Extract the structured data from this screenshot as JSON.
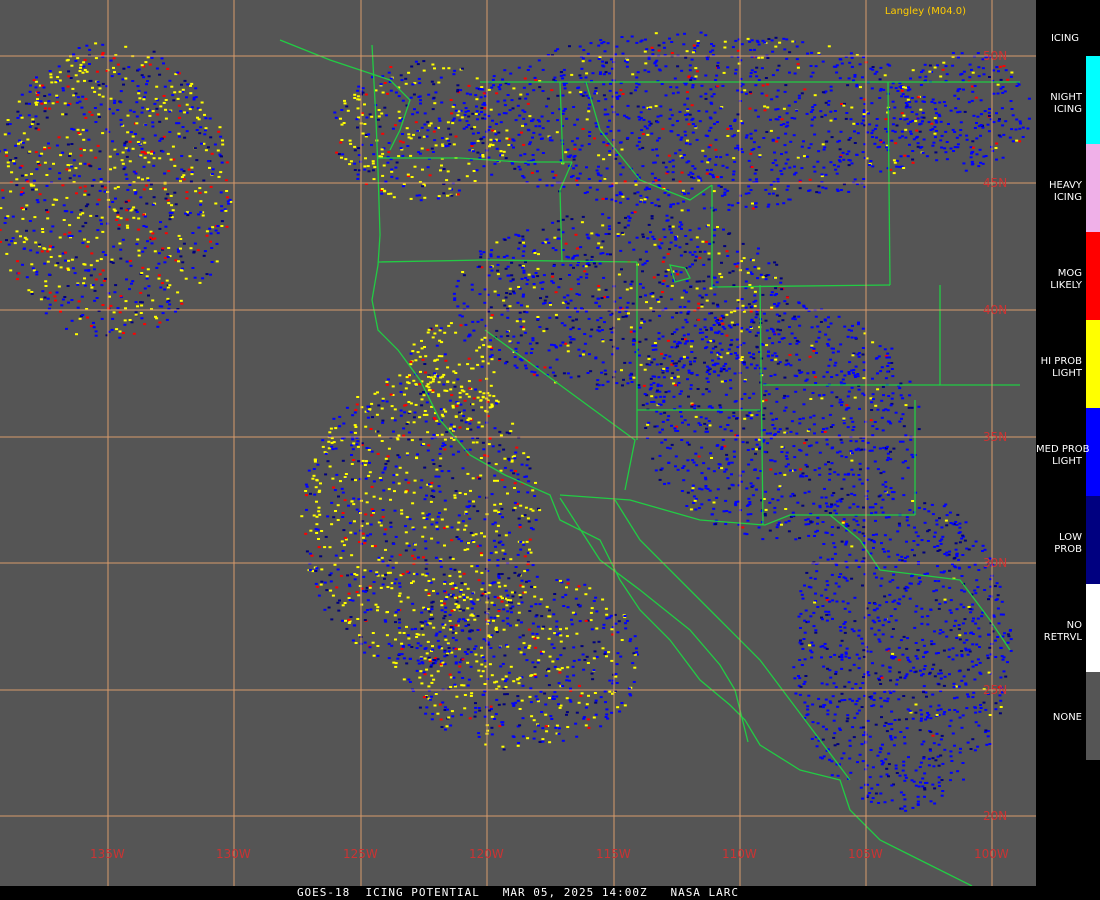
{
  "title": "GOES-18  ICING POTENTIAL   MAR 05, 2025 14:00Z   NASA LARC",
  "credit": "Langley (M04.0)",
  "legend": {
    "title": "ICING",
    "items": [
      {
        "label": "NIGHT\nICING",
        "color": "#00ffff"
      },
      {
        "label": "HEAVY\nICING",
        "color": "#f0b0e8"
      },
      {
        "label": "MOG\nLIKELY",
        "color": "#ff0000"
      },
      {
        "label": "HI PROB\nLIGHT",
        "color": "#ffff00"
      },
      {
        "label": "MED PROB\nLIGHT",
        "color": "#0000ff"
      },
      {
        "label": "LOW\nPROB",
        "color": "#000080"
      },
      {
        "label": "NO\nRETRVL",
        "color": "#ffffff"
      },
      {
        "label": "NONE",
        "color": "#555555"
      }
    ]
  },
  "lat_labels": [
    "50N",
    "45N",
    "40N",
    "35N",
    "30N",
    "25N",
    "20N"
  ],
  "lon_labels": [
    "135W",
    "130W",
    "125W",
    "120W",
    "115W",
    "110W",
    "105W",
    "100W"
  ],
  "colors": {
    "background": "#555555",
    "grid": "#d89a6a",
    "border": "#22cc44",
    "grid_label": "#cc3333"
  }
}
